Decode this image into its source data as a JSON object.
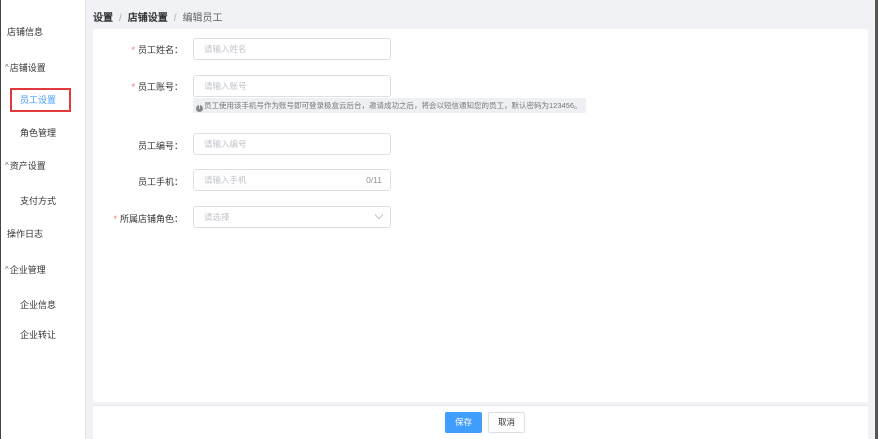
{
  "sidebar": {
    "items": [
      {
        "label": "店铺信息"
      },
      {
        "label": "店铺设置"
      },
      {
        "label": "员工设置"
      },
      {
        "label": "角色管理"
      },
      {
        "label": "资产设置"
      },
      {
        "label": "支付方式"
      },
      {
        "label": "操作日志"
      },
      {
        "label": "企业管理"
      },
      {
        "label": "企业信息"
      },
      {
        "label": "企业转让"
      }
    ],
    "caret": "^"
  },
  "breadcrumb": {
    "items": [
      "设置",
      "店铺设置",
      "编辑员工"
    ],
    "separator": "/"
  },
  "form": {
    "name": {
      "label": "员工姓名：",
      "placeholder": "请输入姓名",
      "required": "*"
    },
    "account": {
      "label": "员工账号：",
      "placeholder": "请输入账号",
      "required": "*",
      "hint": "员工使用该手机号作为账号即可登录极盒云后台，邀请成功之后，将会以短信通知您的员工，默认密码为123456。"
    },
    "number": {
      "label": "员工编号：",
      "placeholder": "请输入编号"
    },
    "phone": {
      "label": "员工手机：",
      "placeholder": "请输入手机",
      "counter": "0/11"
    },
    "role": {
      "label": "所属店铺角色：",
      "placeholder": "请选择",
      "required": "*"
    }
  },
  "footer": {
    "save_label": "保存",
    "cancel_label": "取消"
  },
  "colors": {
    "primary": "#409eff",
    "required": "#f56c6c",
    "highlight_border": "#e0393e"
  }
}
